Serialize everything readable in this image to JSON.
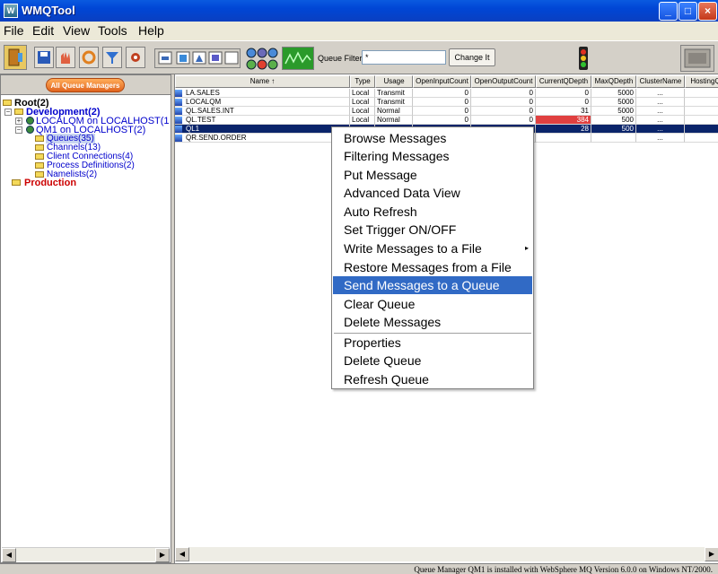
{
  "window": {
    "title": "WMQTool",
    "app_icon_text": "W"
  },
  "window_buttons": {
    "minimize": "_",
    "maximize": "□",
    "close": "×"
  },
  "menubar": {
    "file": "File",
    "edit": "Edit",
    "view": "View",
    "tools": "Tools",
    "help": "Help"
  },
  "toolbar": {
    "filter_label": "Queue Filter:",
    "filter_value": "*",
    "change_label": "Change It"
  },
  "left": {
    "all_qm_button": "All Queue Managers",
    "tree": {
      "root": "Root(2)",
      "development": "Development(2)",
      "localqm": "LOCALQM on LOCALHOST(1",
      "qm1": "QM1 on LOCALHOST(2)",
      "queues": "Queues(35)",
      "channels": "Channels(13)",
      "client_connections": "Client Connections(4)",
      "process_definitions": "Process Definitions(2)",
      "namelists": "Namelists(2)",
      "production": "Production"
    }
  },
  "table": {
    "columns": [
      "Name ↑",
      "Type",
      "Usage",
      "OpenInputCount",
      "OpenOutputCount",
      "CurrentQDepth",
      "MaxQDepth",
      "ClusterName",
      "HostingQ"
    ],
    "rows": [
      {
        "name": "LA.SALES",
        "type": "Local",
        "usage": "Transmit",
        "in": "0",
        "out": "0",
        "depth": "0",
        "max": "5000",
        "cluster": "...",
        "hosting": ""
      },
      {
        "name": "LOCALQM",
        "type": "Local",
        "usage": "Transmit",
        "in": "0",
        "out": "0",
        "depth": "0",
        "max": "5000",
        "cluster": "...",
        "hosting": ""
      },
      {
        "name": "QL.SALES.INT",
        "type": "Local",
        "usage": "Normal",
        "in": "0",
        "out": "0",
        "depth": "31",
        "max": "5000",
        "cluster": "...",
        "hosting": ""
      },
      {
        "name": "QL.TEST",
        "type": "Local",
        "usage": "Normal",
        "in": "0",
        "out": "0",
        "depth": "384",
        "max": "500",
        "cluster": "...",
        "hosting": ""
      },
      {
        "name": "QL1",
        "type": "",
        "usage": "",
        "in": "",
        "out": "",
        "depth": "28",
        "max": "500",
        "cluster": "...",
        "hosting": ""
      },
      {
        "name": "QR.SEND.ORDER",
        "type": "",
        "usage": "",
        "in": "",
        "out": "",
        "depth": "",
        "max": "",
        "cluster": "...",
        "hosting": ""
      }
    ]
  },
  "context_menu": {
    "browse": "Browse Messages",
    "filtering": "Filtering Messages",
    "put": "Put Message",
    "advanced": "Advanced Data View",
    "auto_refresh": "Auto Refresh",
    "trigger": "Set Trigger ON/OFF",
    "write": "Write Messages to a File",
    "restore": "Restore Messages from a File",
    "send": "Send Messages to a Queue",
    "clear": "Clear Queue",
    "delete_msgs": "Delete Messages",
    "properties": "Properties",
    "delete_queue": "Delete Queue",
    "refresh_queue": "Refresh Queue"
  },
  "status": {
    "text": "Queue Manager QM1 is installed with WebSphere MQ Version 6.0.0 on Windows NT/2000."
  },
  "colors": {
    "highlight": "#316ac5",
    "selected_row": "#0a246a",
    "depth_alert": "#e04040",
    "tree_blue": "#0000cc",
    "tree_red": "#cc0000"
  },
  "icons": [
    "exit-icon",
    "save-icon",
    "hand-icon",
    "refresh-icon",
    "filter-icon",
    "settings-icon",
    "traffic-light-icon",
    "monitor-icon"
  ]
}
